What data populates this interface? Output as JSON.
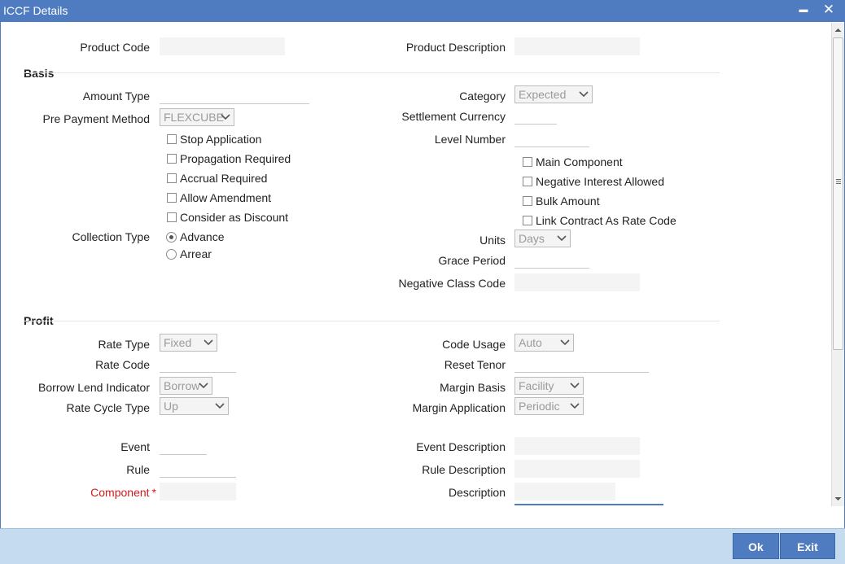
{
  "window": {
    "title": "ICCF Details",
    "minimize": "▬",
    "close": "✕"
  },
  "header": {
    "product_code_label": "Product Code",
    "product_description_label": "Product Description"
  },
  "basis": {
    "section_title": "Basis",
    "amount_type_label": "Amount Type",
    "pre_payment_method_label": "Pre Payment Method",
    "pre_payment_method_value": "FLEXCUBE",
    "category_label": "Category",
    "category_value": "Expected",
    "settlement_currency_label": "Settlement Currency",
    "level_number_label": "Level Number",
    "checkboxes_left": [
      "Stop Application",
      "Propagation Required",
      "Accrual Required",
      "Allow Amendment",
      "Consider as Discount"
    ],
    "checkboxes_right": [
      "Main Component",
      "Negative Interest Allowed",
      "Bulk Amount",
      "Link Contract As Rate Code"
    ],
    "collection_type_label": "Collection Type",
    "collection_options": [
      "Advance",
      "Arrear"
    ],
    "collection_selected": "Advance",
    "units_label": "Units",
    "units_value": "Days",
    "grace_period_label": "Grace Period",
    "negative_class_code_label": "Negative Class Code"
  },
  "profit": {
    "section_title": "Profit",
    "rate_type_label": "Rate Type",
    "rate_type_value": "Fixed",
    "rate_code_label": "Rate Code",
    "borrow_lend_label": "Borrow Lend Indicator",
    "borrow_lend_value": "Borrow",
    "rate_cycle_type_label": "Rate Cycle Type",
    "rate_cycle_type_value": "Up",
    "code_usage_label": "Code Usage",
    "code_usage_value": "Auto",
    "reset_tenor_label": "Reset Tenor",
    "margin_basis_label": "Margin Basis",
    "margin_basis_value": "Facility",
    "margin_application_label": "Margin Application",
    "margin_application_value": "Periodic",
    "event_label": "Event",
    "rule_label": "Rule",
    "component_label": "Component",
    "required_marker": "*",
    "event_description_label": "Event Description",
    "rule_description_label": "Rule Description",
    "description_label": "Description"
  },
  "footer": {
    "ok_label": "Ok",
    "exit_label": "Exit"
  },
  "colors": {
    "titlebar": "#4f7cc0",
    "footer": "#c5dcf0",
    "required": "#d01b1b"
  }
}
